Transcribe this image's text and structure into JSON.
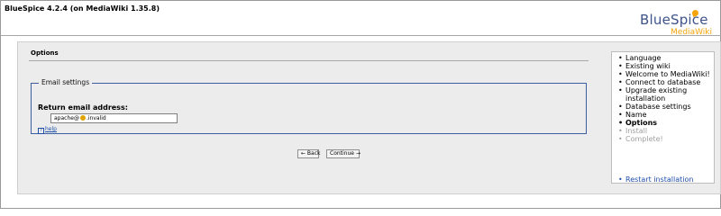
{
  "header": {
    "title": "BlueSpice 4.2.4 (on MediaWiki 1.35.8)",
    "logo_main": "BlueSpice",
    "logo_sub": "MediaWiki"
  },
  "main": {
    "section_title": "Options",
    "fieldset_legend": "Email settings",
    "field_label": "Return email address:",
    "email_value_left": "apache@",
    "email_value_right": ".invalid",
    "help_label": "help"
  },
  "buttons": {
    "back": "← Back",
    "continue": "Continue →"
  },
  "steps": [
    {
      "label": "Language",
      "state": "done"
    },
    {
      "label": "Existing wiki",
      "state": "done"
    },
    {
      "label": "Welcome to MediaWiki!",
      "state": "done"
    },
    {
      "label": "Connect to database",
      "state": "done"
    },
    {
      "label": "Upgrade existing installation",
      "state": "done"
    },
    {
      "label": "Database settings",
      "state": "done"
    },
    {
      "label": "Name",
      "state": "done"
    },
    {
      "label": "Options",
      "state": "current"
    },
    {
      "label": "Install",
      "state": "future"
    },
    {
      "label": "Complete!",
      "state": "future"
    }
  ],
  "restart_label": "Restart installation",
  "colors": {
    "brand_blue": "#3e5389",
    "brand_orange": "#f4a50b",
    "link": "#1f4fa8",
    "fieldset_border": "#3b5ea0"
  },
  "icons": {
    "help": "help-icon",
    "email_domain": "host-icon",
    "logo_mark": "bluespice-logo"
  }
}
